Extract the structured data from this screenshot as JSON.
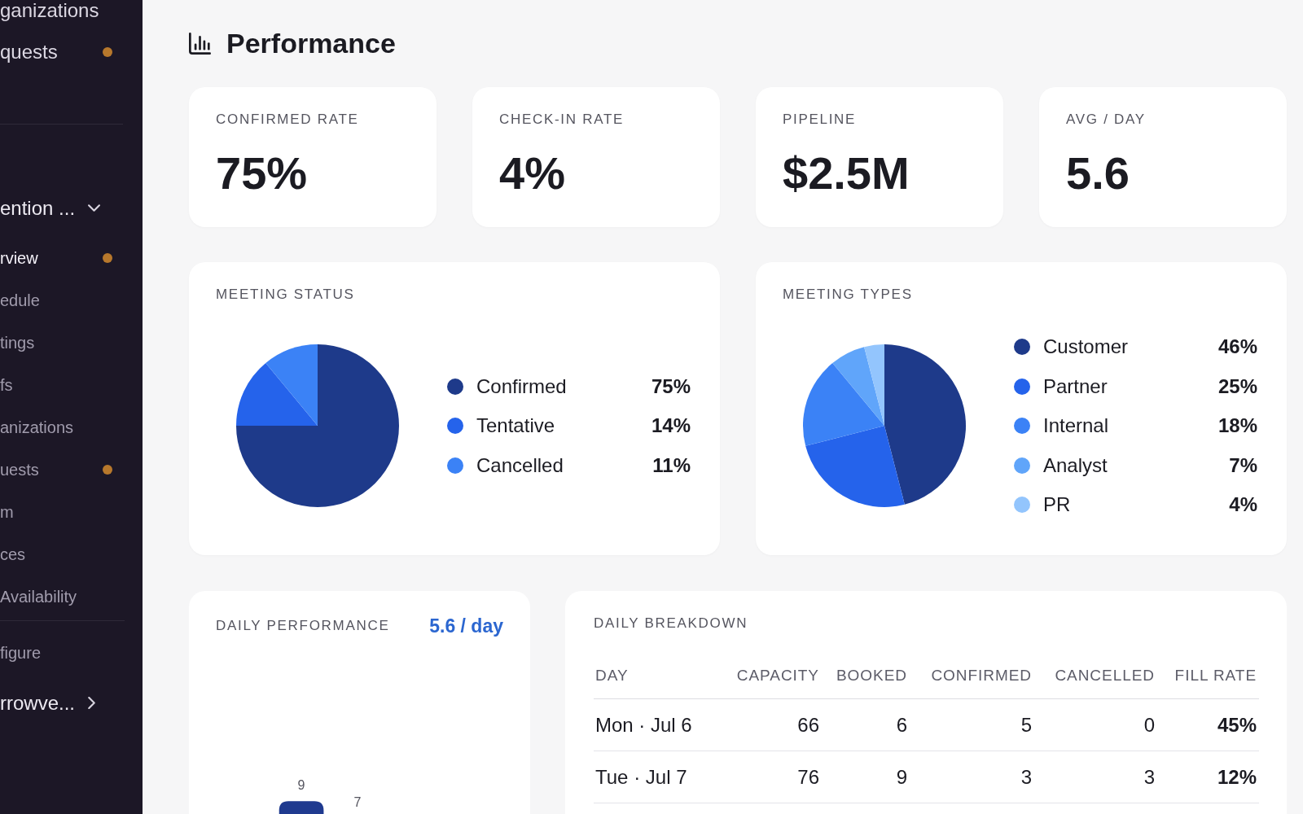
{
  "sidebar": {
    "top_items": [
      {
        "label": "ganizations",
        "unread": false
      },
      {
        "label": "quests",
        "unread": true
      }
    ],
    "group": {
      "label": "ention ...",
      "expanded": true,
      "children": [
        {
          "label": "rview",
          "selected": true,
          "unread": true
        },
        {
          "label": "edule",
          "selected": false,
          "unread": false
        },
        {
          "label": "tings",
          "selected": false,
          "unread": false
        },
        {
          "label": "fs",
          "selected": false,
          "unread": false
        },
        {
          "label": "anizations",
          "selected": false,
          "unread": false
        },
        {
          "label": "uests",
          "selected": false,
          "unread": true
        },
        {
          "label": "m",
          "selected": false,
          "unread": false
        },
        {
          "label": "ces",
          "selected": false,
          "unread": false
        },
        {
          "label": "Availability",
          "selected": false,
          "unread": false
        }
      ]
    },
    "bottom_items": [
      {
        "label": "figure"
      }
    ],
    "footer_group": {
      "label": "rrowve...",
      "expanded": false
    }
  },
  "page": {
    "title": "Performance"
  },
  "stats": [
    {
      "label": "CONFIRMED RATE",
      "value": "75%"
    },
    {
      "label": "CHECK-IN RATE",
      "value": "4%"
    },
    {
      "label": "PIPELINE",
      "value": "$2.5M"
    },
    {
      "label": "AVG / DAY",
      "value": "5.6"
    }
  ],
  "meeting_status": {
    "title": "MEETING STATUS",
    "legend": [
      {
        "label": "Confirmed",
        "value": "75%",
        "color": "#1e3a8a"
      },
      {
        "label": "Tentative",
        "value": "14%",
        "color": "#2563eb"
      },
      {
        "label": "Cancelled",
        "value": "11%",
        "color": "#3b82f6"
      }
    ],
    "chart_data": {
      "type": "pie",
      "values": [
        75,
        14,
        11
      ]
    }
  },
  "meeting_types": {
    "title": "MEETING TYPES",
    "legend": [
      {
        "label": "Customer",
        "value": "46%",
        "color": "#1e3a8a"
      },
      {
        "label": "Partner",
        "value": "25%",
        "color": "#2563eb"
      },
      {
        "label": "Internal",
        "value": "18%",
        "color": "#3b82f6"
      },
      {
        "label": "Analyst",
        "value": "7%",
        "color": "#60a5fa"
      },
      {
        "label": "PR",
        "value": "4%",
        "color": "#93c5fd"
      }
    ],
    "chart_data": {
      "type": "pie",
      "values": [
        46,
        25,
        18,
        7,
        4
      ]
    }
  },
  "daily_performance": {
    "title": "DAILY PERFORMANCE",
    "average": "5.6 / day",
    "bar_labels": [
      "9",
      "7"
    ]
  },
  "daily_breakdown": {
    "title": "DAILY BREAKDOWN",
    "columns": [
      "DAY",
      "CAPACITY",
      "BOOKED",
      "CONFIRMED",
      "CANCELLED",
      "FILL RATE"
    ],
    "rows": [
      [
        "Mon · Jul 6",
        "66",
        "6",
        "5",
        "0",
        "45%"
      ],
      [
        "Tue · Jul 7",
        "76",
        "9",
        "3",
        "3",
        "12%"
      ]
    ]
  }
}
